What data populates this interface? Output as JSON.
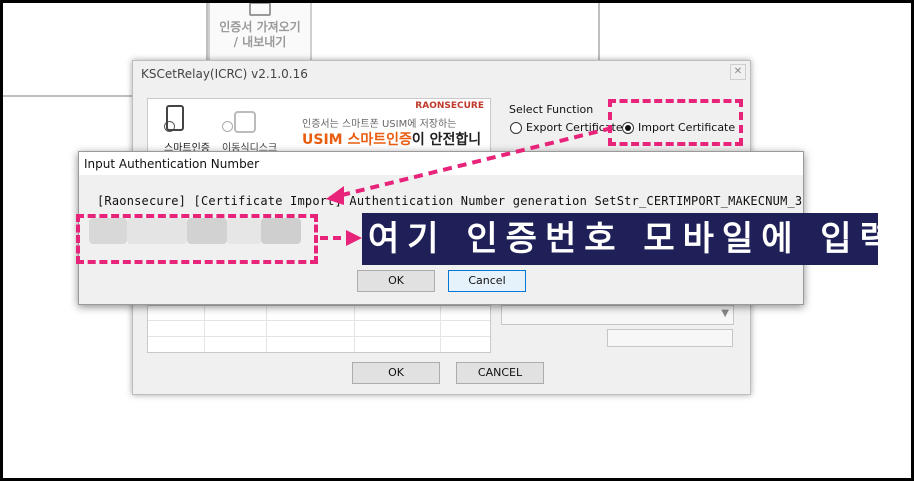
{
  "background": {
    "tile_button_label_line1": "인증서 가져오기",
    "tile_button_label_line2": "/ 내보내기"
  },
  "main_window": {
    "title": "KSCetRelay(ICRC) v2.1.0.16",
    "banner": {
      "option_smartcert": "스마트인증",
      "option_removable": "이동식디스크",
      "brand": "RAONSECURE",
      "tagline_small": "인증서는 스마트폰 USIM에 저장하는",
      "tagline_highlight": "USIM 스마트인증",
      "tagline_rest": "이 안전합니다"
    },
    "select_function": {
      "label": "Select Function",
      "export_label": "Export Certificate",
      "import_label": "Import Certificate",
      "selected": "import"
    },
    "ok_label": "OK",
    "cancel_label": "CANCEL"
  },
  "dialog": {
    "title": "Input Authentication Number",
    "message": "[Raonsecure] [Certificate Import] Authentication Number generation SetStr_CERTIMPORT_MAKECNUM_3",
    "ok_label": "OK",
    "cancel_label": "Cancel"
  },
  "annotation": {
    "note": "여기 인증번호 모바일에 입력",
    "highlight_color": "#e8237a",
    "note_bg": "#1f2058"
  }
}
